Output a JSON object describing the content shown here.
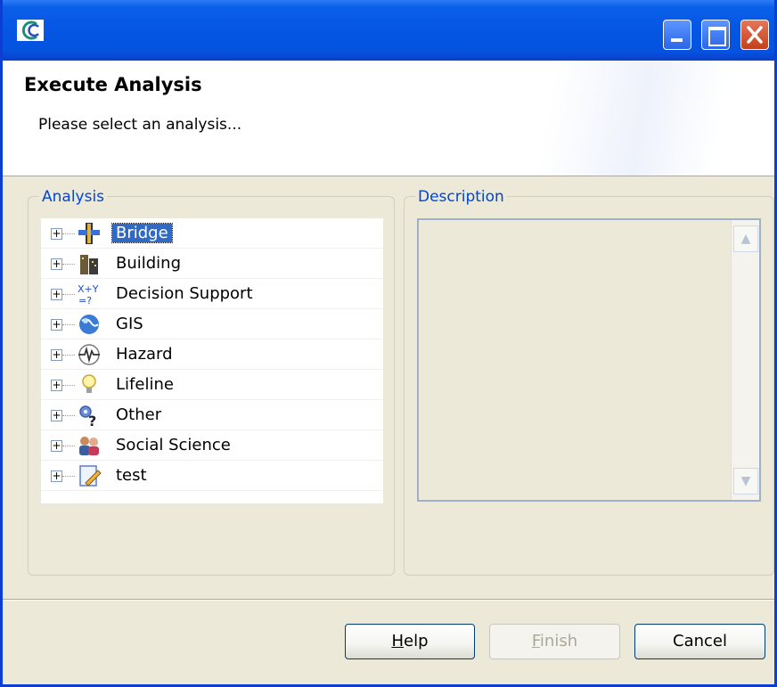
{
  "window": {
    "icon": "app-logo-icon",
    "controls": [
      "minimize-icon",
      "maximize-icon",
      "close-icon"
    ]
  },
  "banner": {
    "title": "Execute Analysis",
    "subtitle": "Please select an analysis..."
  },
  "analysis_group": {
    "legend": "Analysis",
    "items": [
      {
        "label": "Bridge",
        "icon": "bridge-icon",
        "selected": true
      },
      {
        "label": "Building",
        "icon": "building-icon"
      },
      {
        "label": "Decision Support",
        "icon": "decision-support-icon"
      },
      {
        "label": "GIS",
        "icon": "globe-icon"
      },
      {
        "label": "Hazard",
        "icon": "hazard-icon"
      },
      {
        "label": "Lifeline",
        "icon": "lightbulb-icon"
      },
      {
        "label": "Other",
        "icon": "gears-question-icon"
      },
      {
        "label": "Social Science",
        "icon": "people-icon"
      },
      {
        "label": "test",
        "icon": "document-pencil-icon"
      }
    ],
    "expander_glyph": "+"
  },
  "description_group": {
    "legend": "Description",
    "text": ""
  },
  "buttons": {
    "help": {
      "label": "Help",
      "mnemonic": "H",
      "rest": "elp"
    },
    "finish": {
      "label": "Finish",
      "mnemonic": "F",
      "rest": "inish",
      "enabled": false
    },
    "cancel": {
      "label": "Cancel"
    }
  },
  "colors": {
    "title_bar": "#0456e3",
    "selection": "#316ac5",
    "group_legend": "#0046d5",
    "dialog_bg": "#ece9d8"
  }
}
